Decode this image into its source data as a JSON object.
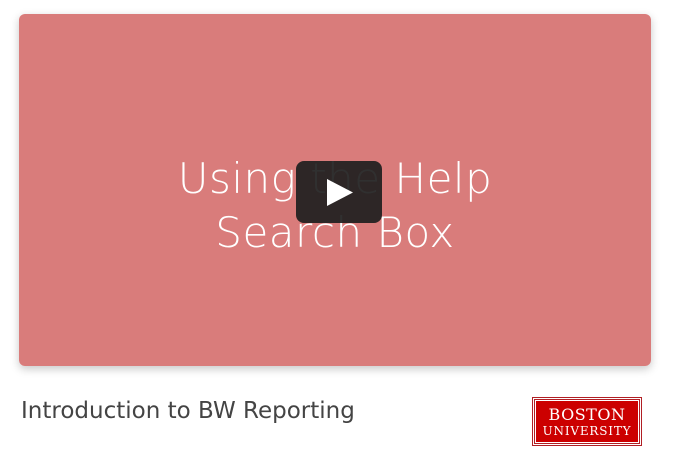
{
  "video": {
    "thumbnail_title_line1": "Using the Help",
    "thumbnail_title_line2": "Search Box",
    "background_color": "#d97c7b",
    "play_icon": "play-icon"
  },
  "caption": {
    "title": "Introduction to BW Reporting"
  },
  "logo": {
    "line1": "BOSTON",
    "line2": "UNIVERSITY",
    "color": "#cc0000"
  }
}
